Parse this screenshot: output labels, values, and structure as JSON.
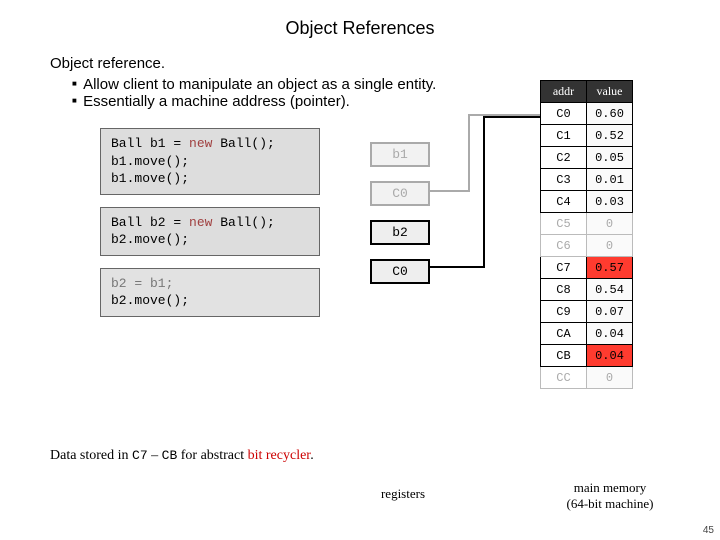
{
  "title": "Object References",
  "heading": "Object reference.",
  "bullets": [
    "Allow client to manipulate an object as a single entity.",
    "Essentially a machine address (pointer)."
  ],
  "code": {
    "block1": {
      "line1a": "Ball b1 = ",
      "line1_kw": "new",
      "line1b": " Ball();",
      "line2": "b1.move();",
      "line3": "b1.move();"
    },
    "block2": {
      "line1a": "Ball b2 = ",
      "line1_kw": "new",
      "line1b": " Ball();",
      "line2": "b2.move();"
    },
    "block3": {
      "line1": "b2 = b1;",
      "line2": "b2.move();"
    }
  },
  "registers": {
    "r0": "b1",
    "r1": "C0",
    "r2": "b2",
    "r3": "C0"
  },
  "memory_header": {
    "addr": "addr",
    "value": "value"
  },
  "memory": {
    "c0": {
      "addr": "C0",
      "val": "0.60"
    },
    "c1": {
      "addr": "C1",
      "val": "0.52"
    },
    "c2": {
      "addr": "C2",
      "val": "0.05"
    },
    "c3": {
      "addr": "C3",
      "val": "0.01"
    },
    "c4": {
      "addr": "C4",
      "val": "0.03"
    },
    "c5": {
      "addr": "C5",
      "val": "0"
    },
    "c6": {
      "addr": "C6",
      "val": "0"
    },
    "c7": {
      "addr": "C7",
      "val": "0.57"
    },
    "c8": {
      "addr": "C8",
      "val": "0.54"
    },
    "c9": {
      "addr": "C9",
      "val": "0.07"
    },
    "ca": {
      "addr": "CA",
      "val": "0.04"
    },
    "cb": {
      "addr": "CB",
      "val": "0.04"
    },
    "cc": {
      "addr": "CC",
      "val": "0"
    }
  },
  "captions": {
    "registers": "registers",
    "memory": "main memory\n(64-bit machine)"
  },
  "bottom": {
    "prefix": "Data stored in ",
    "c7": "C7",
    "dash": " – ",
    "cb": "CB",
    "suffix1": " for abstract ",
    "red": "bit recycler",
    "suffix2": "."
  },
  "pagenum": "45"
}
